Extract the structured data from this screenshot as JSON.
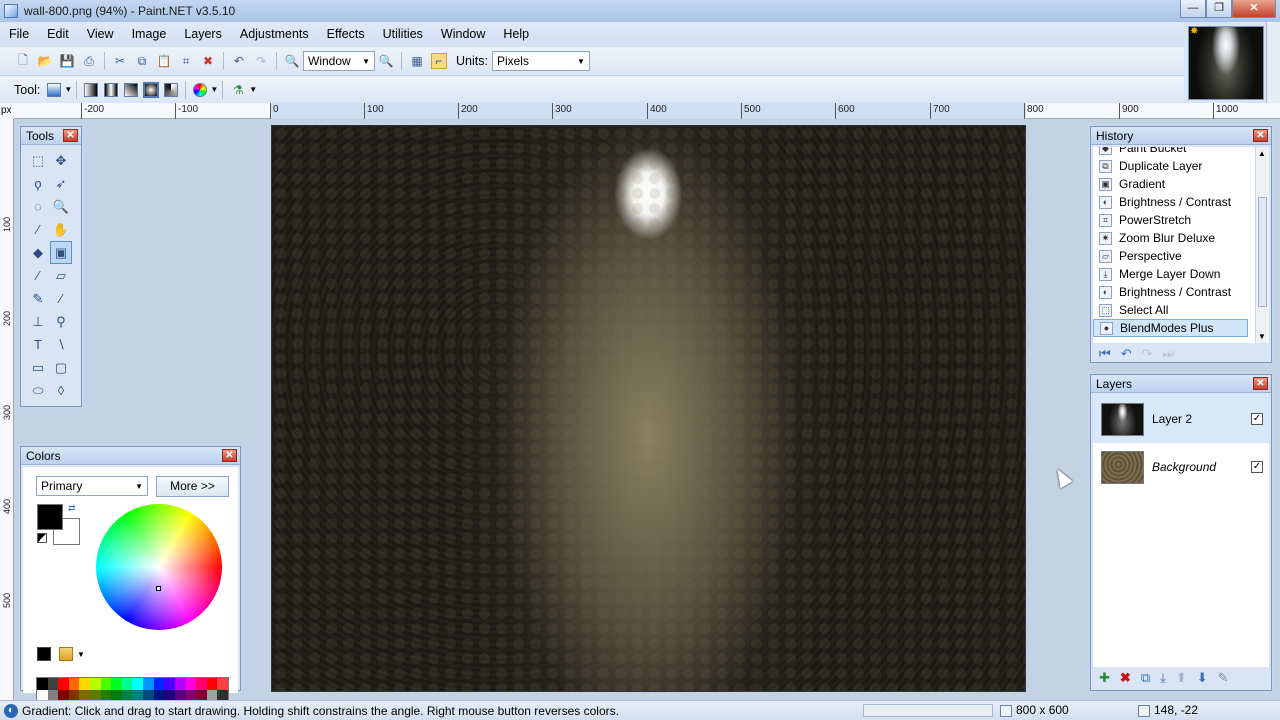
{
  "window": {
    "title": "wall-800.png (94%) - Paint.NET v3.5.10",
    "minimize": "—",
    "maximize": "❐",
    "close": "✕"
  },
  "menu": [
    "File",
    "Edit",
    "View",
    "Image",
    "Layers",
    "Adjustments",
    "Effects",
    "Utilities",
    "Window",
    "Help"
  ],
  "toolbar": {
    "zoom_value": "Window",
    "units_label": "Units:",
    "units_value": "Pixels",
    "tool_label": "Tool:"
  },
  "ruler": {
    "unit": "px",
    "top_labels": [
      "-200",
      "-100",
      "0",
      "100",
      "200",
      "300",
      "400",
      "500",
      "600",
      "700",
      "800",
      "900",
      "1000"
    ],
    "left_labels": [
      "100",
      "200",
      "300",
      "400",
      "500"
    ]
  },
  "tools_window": {
    "title": "Tools",
    "close": "✕"
  },
  "colors_window": {
    "title": "Colors",
    "close": "✕",
    "mode_value": "Primary",
    "more_button": "More >>",
    "primary_color": "#000000",
    "secondary_color": "#ffffff",
    "palette_top": [
      "#000000",
      "#404040",
      "#ff0000",
      "#ff6a00",
      "#ffd800",
      "#b6ff00",
      "#4cff00",
      "#00ff21",
      "#00ff90",
      "#00ffff",
      "#0094ff",
      "#0026ff",
      "#4800ff",
      "#b200ff",
      "#ff00dc",
      "#ff006e",
      "#ff0000",
      "#ff4040"
    ],
    "palette_bottom": [
      "#ffffff",
      "#808080",
      "#7f0000",
      "#7f3300",
      "#7f6a00",
      "#5b7f00",
      "#267f00",
      "#007f0e",
      "#007f46",
      "#007f7f",
      "#004a7f",
      "#00137f",
      "#21007f",
      "#57007f",
      "#7f006e",
      "#7f0037",
      "#a0a0a0",
      "#303030"
    ]
  },
  "history_window": {
    "title": "History",
    "close": "✕",
    "items": [
      {
        "label": "Paint Bucket",
        "icon": "paint-bucket-icon"
      },
      {
        "label": "Duplicate Layer",
        "icon": "duplicate-layer-icon"
      },
      {
        "label": "Gradient",
        "icon": "gradient-icon"
      },
      {
        "label": "Brightness / Contrast",
        "icon": "brightness-contrast-icon"
      },
      {
        "label": "PowerStretch",
        "icon": "powerstretch-icon"
      },
      {
        "label": "Zoom Blur Deluxe",
        "icon": "zoom-blur-icon"
      },
      {
        "label": "Perspective",
        "icon": "perspective-icon"
      },
      {
        "label": "Merge Layer Down",
        "icon": "merge-layer-down-icon"
      },
      {
        "label": "Brightness / Contrast",
        "icon": "brightness-contrast-icon"
      },
      {
        "label": "Select All",
        "icon": "select-all-icon"
      },
      {
        "label": "BlendModes Plus",
        "icon": "blendmodes-plus-icon"
      }
    ],
    "selected_index": 10
  },
  "layers_window": {
    "title": "Layers",
    "close": "✕",
    "layers": [
      {
        "name": "Layer 2",
        "visible": "✓"
      },
      {
        "name": "Background",
        "visible": "✓"
      }
    ]
  },
  "status": {
    "message": "Gradient: Click and drag to start drawing. Holding shift constrains the angle. Right mouse button reverses colors.",
    "image_size": "800 x 600",
    "cursor_position": "148, -22"
  }
}
